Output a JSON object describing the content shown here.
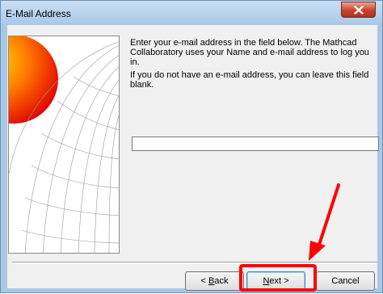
{
  "window": {
    "title": "E-Mail Address"
  },
  "content": {
    "instruction": "Enter your e-mail address in the field below. The Mathcad Collaboratory uses your Name and e-mail address to log you in.",
    "note": "If you do not have an e-mail address, you can leave this field blank."
  },
  "email_field": {
    "value": ""
  },
  "buttons": {
    "back": {
      "mnemonic": "B",
      "rest": "ack",
      "prefix": "< "
    },
    "next": {
      "mnemonic": "N",
      "rest": "ext >"
    },
    "cancel": "Cancel"
  },
  "annotation": {
    "highlight_color": "#ff0000"
  },
  "icons": [
    "close-icon",
    "wizard-globe-art",
    "annotation-arrow"
  ]
}
